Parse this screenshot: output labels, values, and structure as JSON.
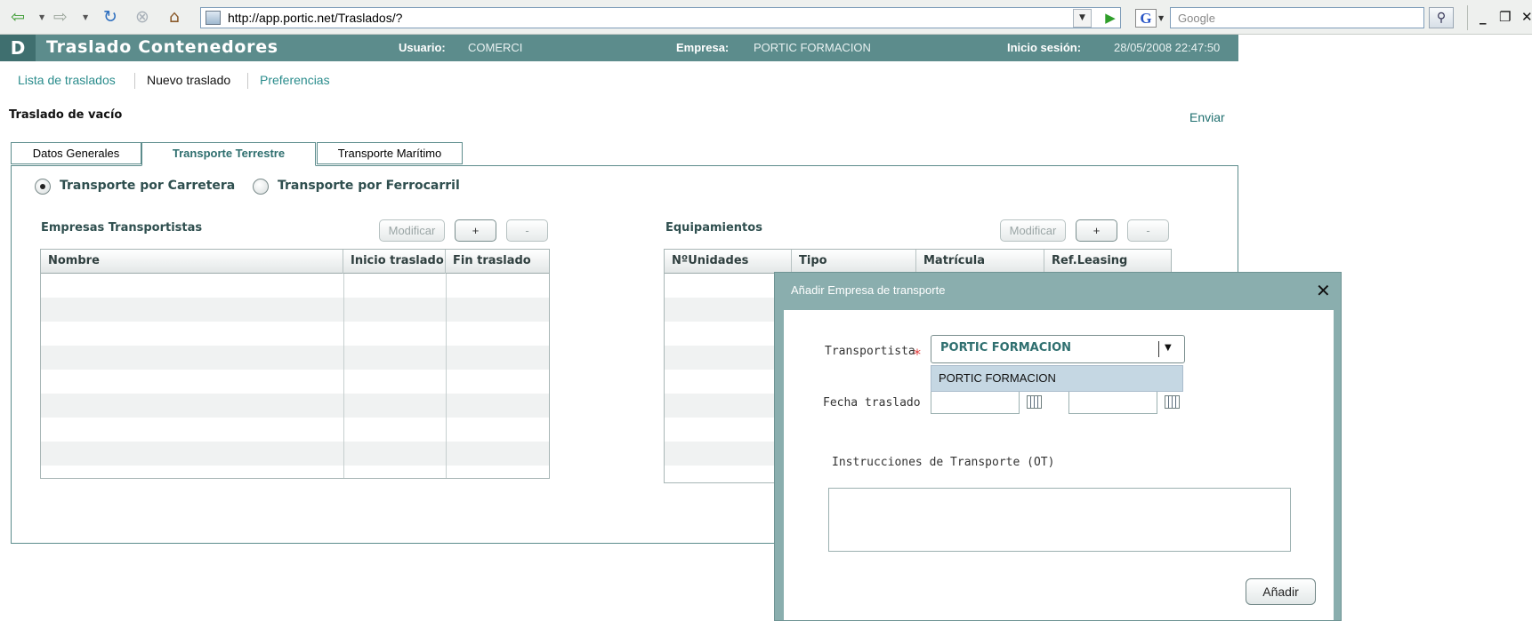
{
  "browser": {
    "url": "http://app.portic.net/Traslados/?",
    "search_placeholder": "Google",
    "google_logo": "G",
    "back_icon": "back-arrow-icon",
    "forward_icon": "forward-arrow-icon",
    "reload_icon": "reload-icon",
    "stop_icon": "stop-icon",
    "home_icon": "home-icon",
    "minimize": "_",
    "restore": "❐",
    "close": "✕"
  },
  "header": {
    "logo": "D",
    "title": "Traslado Contenedores",
    "user_label": "Usuario:",
    "user_value": "COMERCI",
    "company_label": "Empresa:",
    "company_value": "PORTIC FORMACION",
    "session_label": "Inicio sesión:",
    "session_value": "28/05/2008 22:47:50",
    "bg_color": "#5c8c8c"
  },
  "subnav": {
    "items": [
      {
        "label": "Lista de traslados"
      },
      {
        "label": "Nuevo traslado"
      },
      {
        "label": "Preferencias"
      }
    ]
  },
  "page": {
    "heading": "Traslado de vacío",
    "send": "Enviar"
  },
  "tabs": [
    {
      "label": "Datos Generales"
    },
    {
      "label": "Transporte Terrestre"
    },
    {
      "label": "Transporte Marítimo"
    }
  ],
  "transport_mode": {
    "options": [
      {
        "label": "Transporte por Carretera",
        "selected": true
      },
      {
        "label": "Transporte por Ferrocarril",
        "selected": false
      }
    ]
  },
  "carriers": {
    "title": "Empresas Transportistas",
    "modify": "Modificar",
    "add": "+",
    "remove": "-",
    "columns": [
      "Nombre",
      "Inicio traslado",
      "Fin traslado"
    ]
  },
  "equipment": {
    "title": "Equipamientos",
    "modify": "Modificar",
    "add": "+",
    "remove": "-",
    "columns": [
      "NºUnidades",
      "Tipo",
      "Matrícula",
      "Ref.Leasing"
    ]
  },
  "modal": {
    "title": "Añadir Empresa de transporte",
    "close": "✕",
    "carrier_label": "Transportista",
    "required_mark": "*",
    "carrier_value": "PORTIC FORMACION",
    "carrier_option": "PORTIC FORMACION",
    "dropdown_arrow": "▼",
    "date_label": "Fecha traslado",
    "ot_label": "Instrucciones de Transporte (OT)",
    "add_button": "Añadir"
  }
}
